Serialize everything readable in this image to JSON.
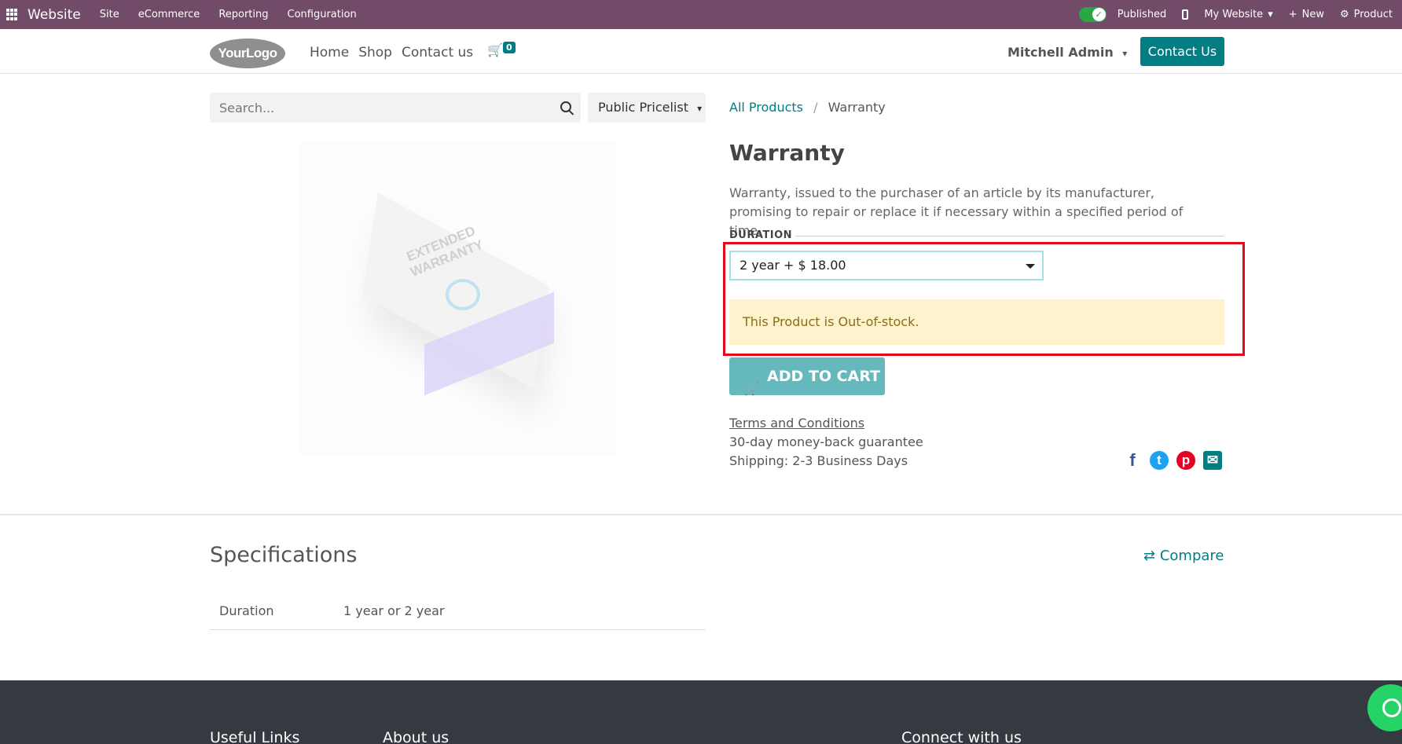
{
  "topbar": {
    "app_name": "Website",
    "menus": [
      "Site",
      "eCommerce",
      "Reporting",
      "Configuration"
    ],
    "published_label": "Published",
    "website_label": "My Website",
    "new_label": "New",
    "product_label": "Product"
  },
  "header": {
    "logo_text": "YourLogo",
    "nav": [
      "Home",
      "Shop",
      "Contact us"
    ],
    "cart_count": "0",
    "user": "Mitchell Admin",
    "contact_button": "Contact Us"
  },
  "search": {
    "placeholder": "Search...",
    "pricelist": "Public Pricelist"
  },
  "product_image": {
    "line1": "EXTENDED",
    "line2": "WARRANTY"
  },
  "breadcrumb": {
    "root": "All Products",
    "current": "Warranty"
  },
  "product": {
    "title": "Warranty",
    "description": "Warranty, issued to the purchaser of an article by its manufacturer, promising to repair or replace it if necessary within a specified period of time.",
    "attribute_label": "DURATION",
    "selected_option": "2 year + $ 18.00",
    "stock_message": "This Product is Out-of-stock.",
    "add_to_cart": "ADD TO CART",
    "terms": "Terms and Conditions",
    "guarantee": "30-day money-back guarantee",
    "shipping": "Shipping: 2-3 Business Days"
  },
  "share_icons": [
    "facebook-icon",
    "twitter-icon",
    "pinterest-icon",
    "email-icon"
  ],
  "specifications": {
    "title": "Specifications",
    "compare_label": "Compare",
    "rows": [
      {
        "key": "Duration",
        "value": "1 year or 2 year"
      }
    ]
  },
  "footer": {
    "cols": [
      "Useful Links",
      "About us",
      "Connect with us"
    ]
  },
  "colors": {
    "admin_bar": "#714b67",
    "primary": "#017e84",
    "highlight": "#e3071a"
  }
}
